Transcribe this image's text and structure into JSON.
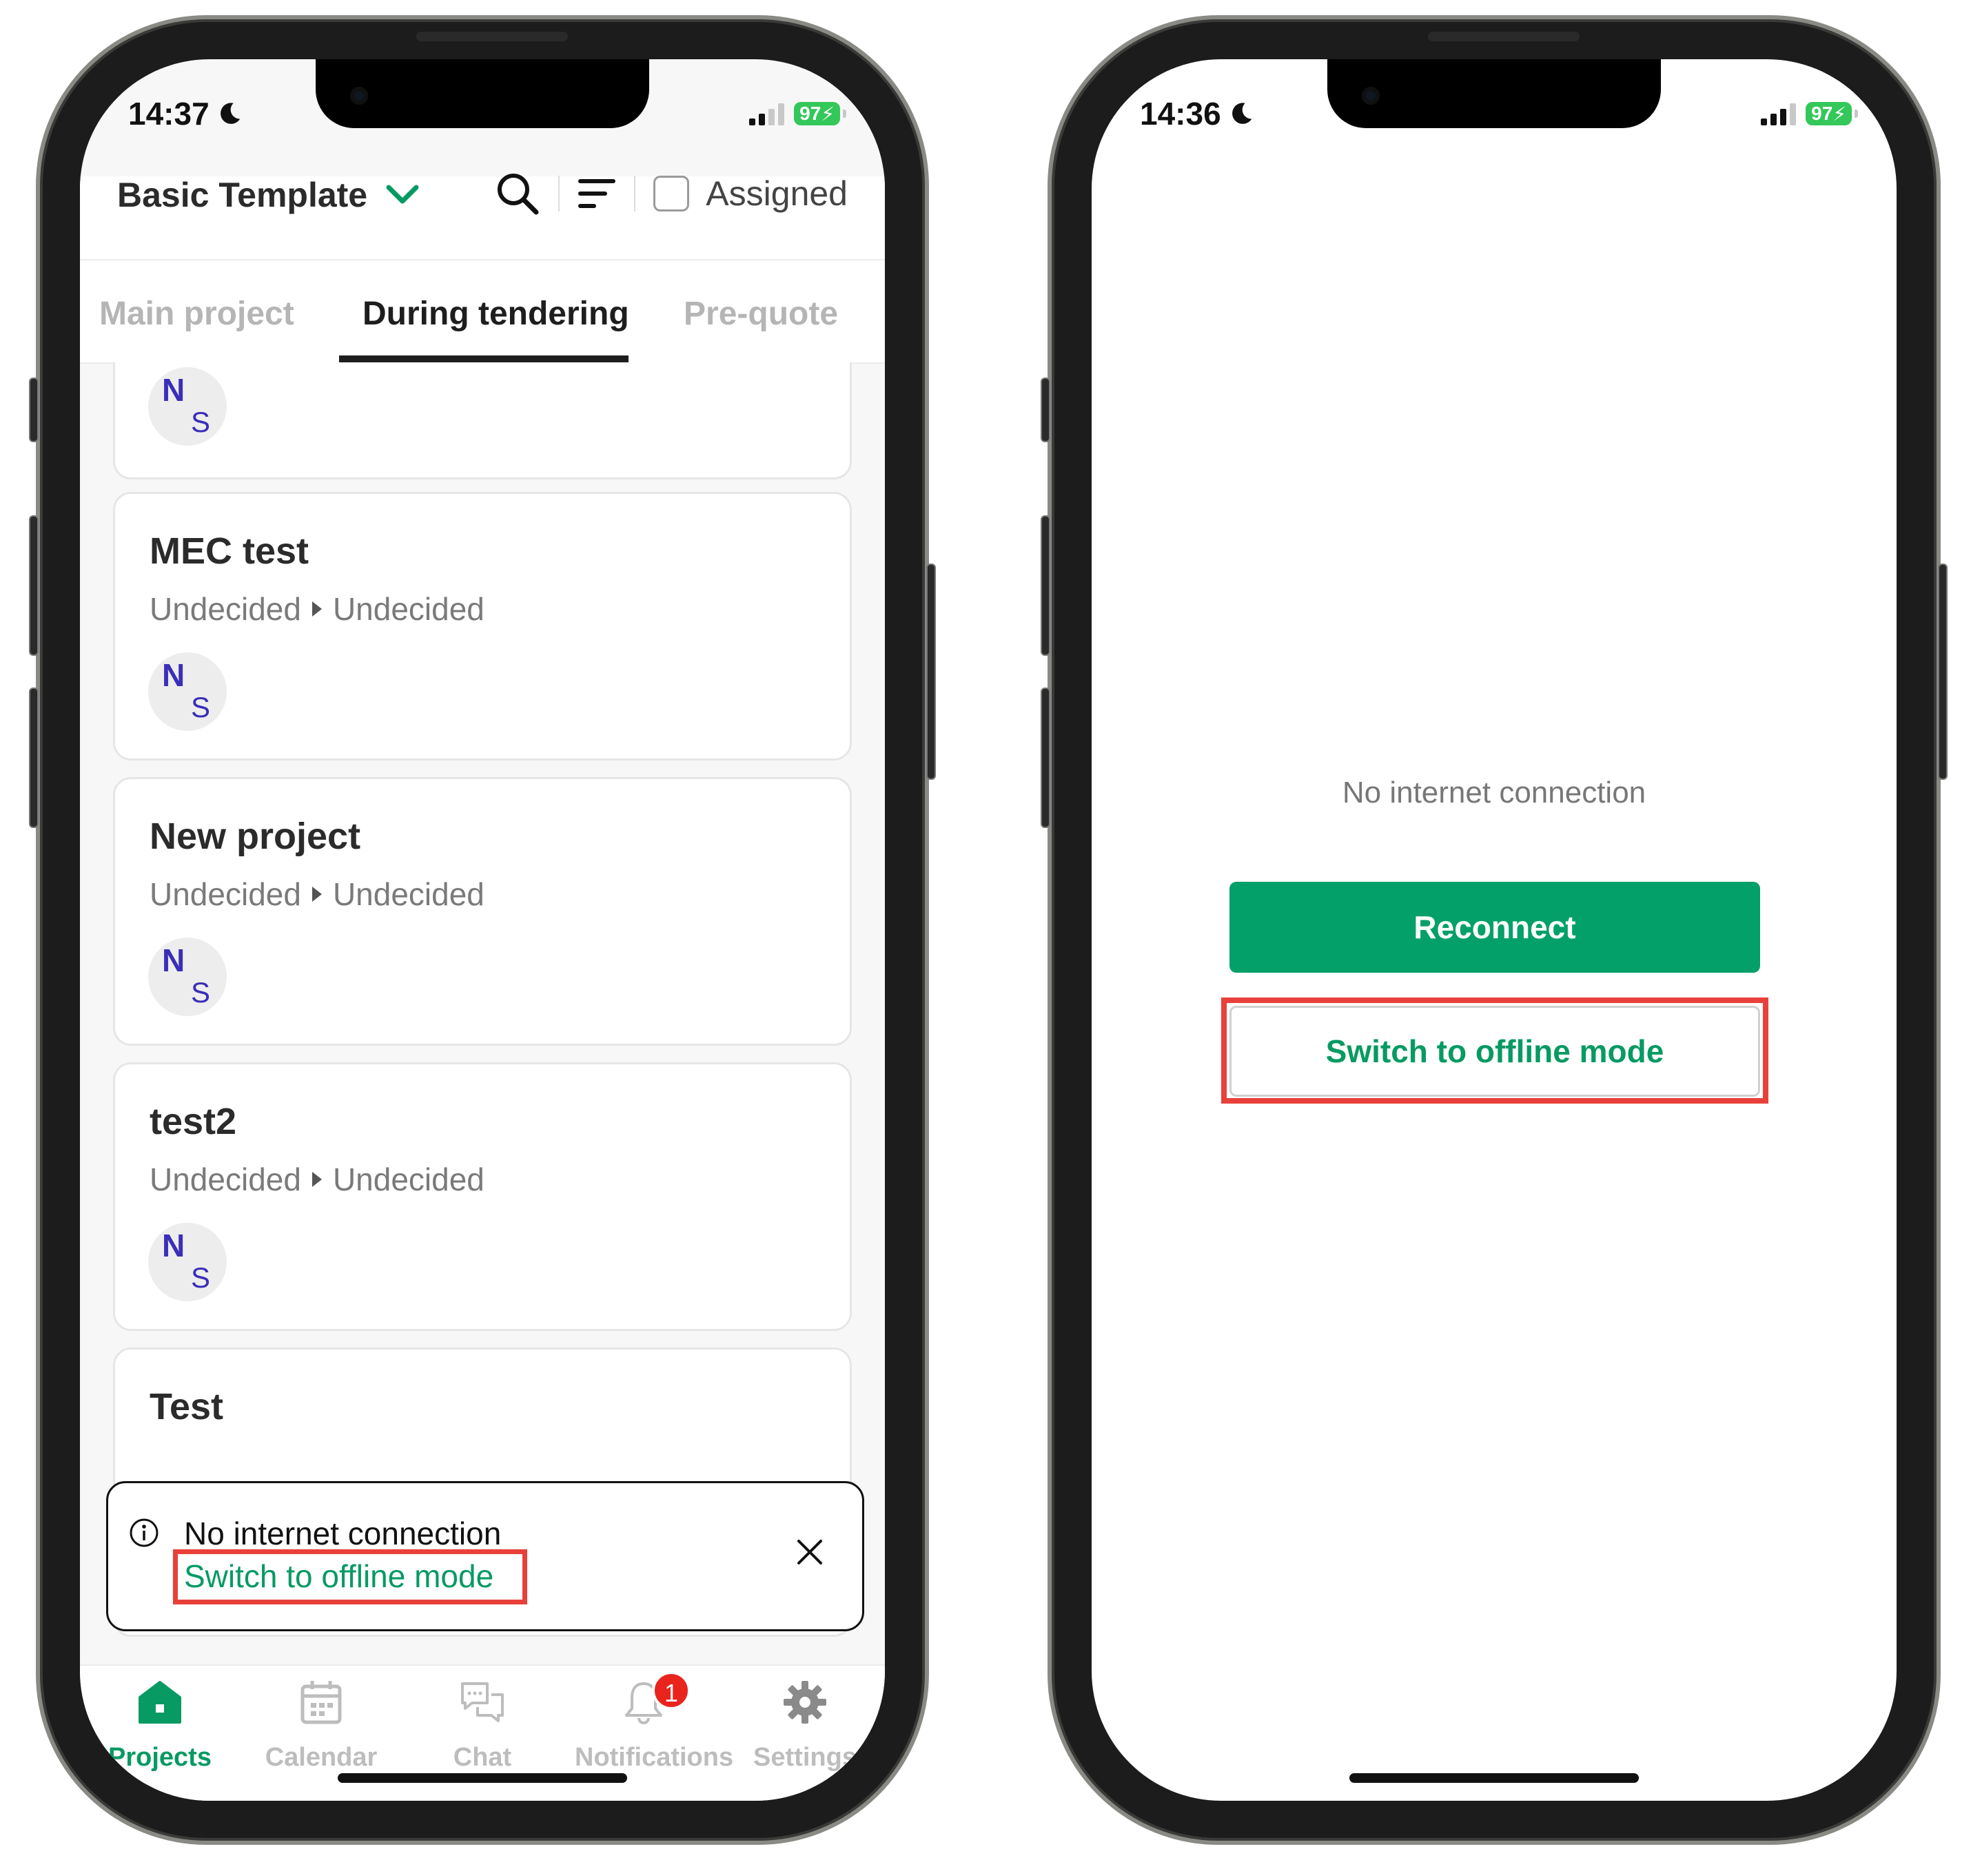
{
  "left_screen": {
    "status": {
      "time": "14:37",
      "battery": "97"
    },
    "header": {
      "template_title": "Basic Template",
      "assigned_label": "Assigned"
    },
    "tabs": [
      {
        "label": "Main project"
      },
      {
        "label": "During tendering"
      },
      {
        "label": "Pre-quote"
      }
    ],
    "cards": [
      {
        "title": "",
        "from": "",
        "to": "",
        "avatar_top": "N",
        "avatar_bottom": "S"
      },
      {
        "title": "MEC test",
        "from": "Undecided",
        "to": "Undecided",
        "avatar_top": "N",
        "avatar_bottom": "S"
      },
      {
        "title": "New project",
        "from": "Undecided",
        "to": "Undecided",
        "avatar_top": "N",
        "avatar_bottom": "S"
      },
      {
        "title": "test2",
        "from": "Undecided",
        "to": "Undecided",
        "avatar_top": "N",
        "avatar_bottom": "S"
      },
      {
        "title": "Test",
        "from": "",
        "to": "",
        "avatar_top": "",
        "avatar_bottom": ""
      }
    ],
    "toast": {
      "message": "No internet connection",
      "link": "Switch to offline mode"
    },
    "tabbar": [
      {
        "label": "Projects",
        "icon": "home-icon"
      },
      {
        "label": "Calendar",
        "icon": "calendar-icon"
      },
      {
        "label": "Chat",
        "icon": "chat-icon"
      },
      {
        "label": "Notifications",
        "icon": "bell-icon",
        "badge": "1"
      },
      {
        "label": "Settings",
        "icon": "gear-icon"
      }
    ]
  },
  "right_screen": {
    "status": {
      "time": "14:36",
      "battery": "97"
    },
    "message": "No internet connection",
    "reconnect_label": "Reconnect",
    "offline_label": "Switch to offline mode"
  },
  "colors": {
    "accent_green": "#04a06a",
    "highlight_red": "#e8403a",
    "avatar_blue": "#3b2eb8"
  }
}
